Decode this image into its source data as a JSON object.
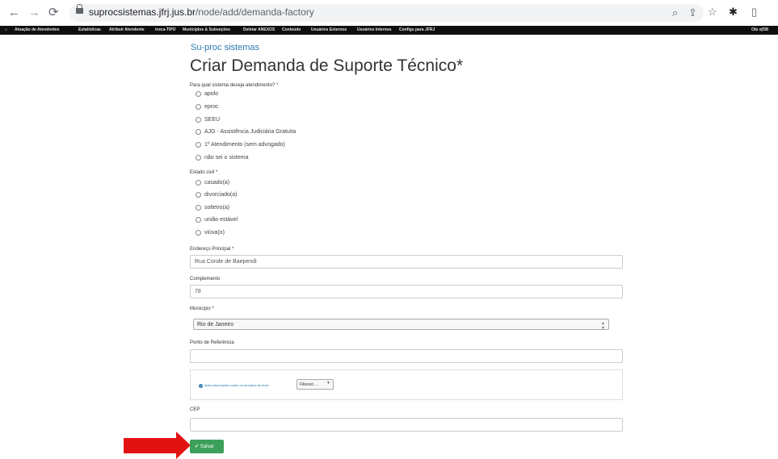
{
  "browser": {
    "url_host": "suprocsistemas.jfrj.jus.br",
    "url_path": "/node/add/demanda-factory",
    "icons": [
      "back-icon",
      "forward-icon",
      "reload-icon",
      "lock-icon",
      "zoom-icon",
      "share-icon",
      "star-icon",
      "extensions-icon",
      "sidepanel-icon"
    ]
  },
  "toolbar": {
    "home_icon": "home-icon",
    "items": [
      "Atuação de Atendentes",
      "Estatísticas",
      "Atribuir Atendente",
      "troca-TIPO",
      "Municípios & Subseções",
      "Deletar ANEXOS",
      "Conteúdo",
      "Usuários Externos",
      "Usuários Internos",
      "Configs para JFRJ"
    ],
    "user_greeting": "Olá vjf38"
  },
  "page": {
    "site_name": "Su-proc sistemas",
    "title": "Criar Demanda de Suporte Técnico*"
  },
  "form": {
    "sistema": {
      "label": "Para qual sistema deseja atendimento? *",
      "options": [
        "apolo",
        "eproc",
        "SEEU",
        "AJG - Assistência Judiciária Gratuita",
        "1º Atendimento (sem advogado)",
        "não sei o sistema"
      ]
    },
    "estado_civil": {
      "label": "Estado civil *",
      "options": [
        "casado(a)",
        "divorciado(a)",
        "solteiro(a)",
        "união estável",
        "viúva(o)"
      ]
    },
    "endereco": {
      "label": "Endereço Principal *",
      "value": "Rua Conde de Baependi"
    },
    "complemento": {
      "label": "Complemento",
      "value": "78"
    },
    "municipio": {
      "label": "Município *",
      "value": "Rio de Janeiro"
    },
    "ponto_referencia": {
      "label": "Ponto de Referência",
      "value": ""
    },
    "formato": {
      "link": "Mais informações sobre os formatos de texto",
      "value": "Filtered ..."
    },
    "cep": {
      "label": "CEP",
      "value": ""
    },
    "save_label": "Salvar"
  },
  "colors": {
    "accent": "#2a7ab0",
    "save": "#3da05a",
    "annotation_arrow": "#e31212",
    "admin_bar": "#0f0f0f"
  }
}
